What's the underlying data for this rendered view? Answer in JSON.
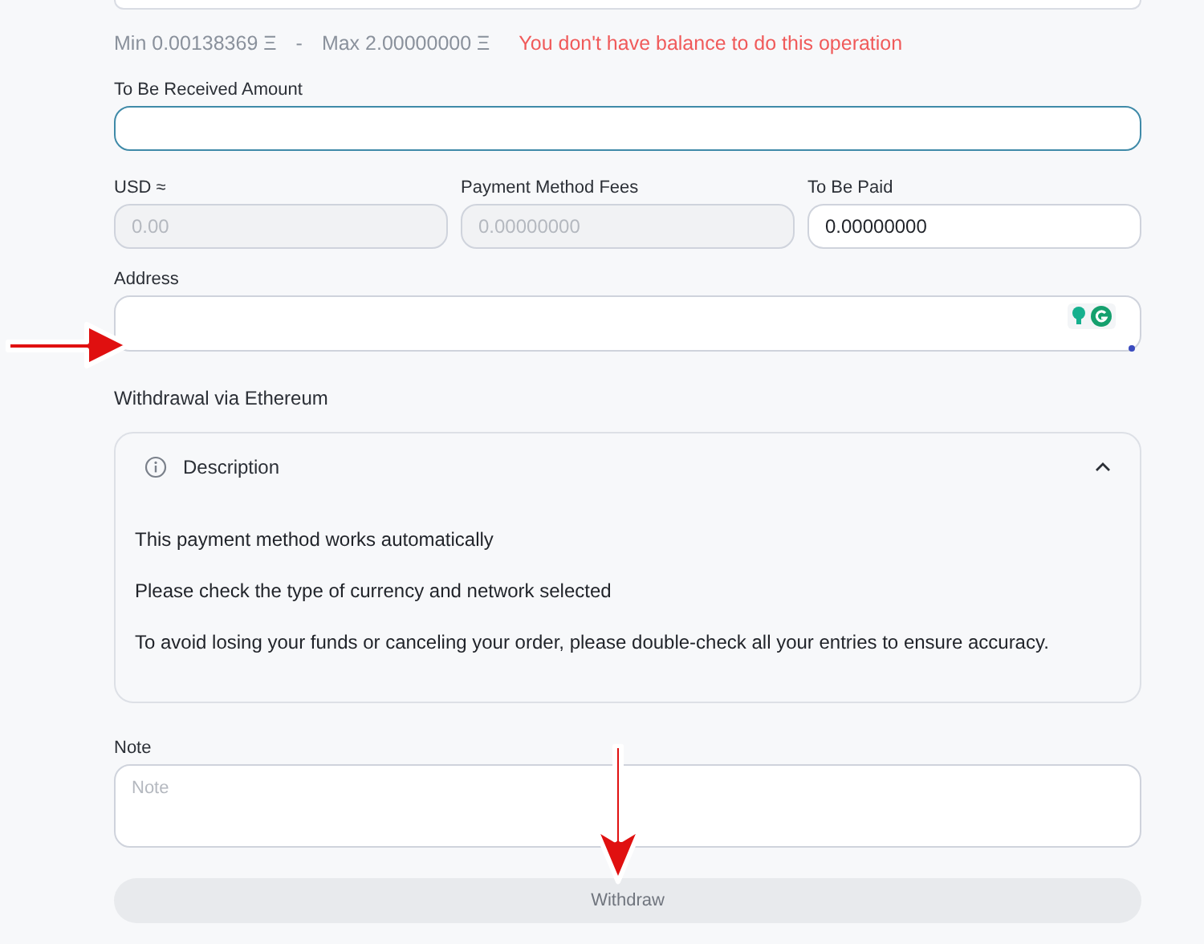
{
  "limits": {
    "min": "Min 0.00138369 Ξ",
    "separator": "-",
    "max": "Max 2.00000000 Ξ",
    "error": "You don't have balance to do this operation"
  },
  "received": {
    "label": "To Be Received Amount",
    "focused": true
  },
  "amounts": [
    {
      "label": "USD ≈",
      "value": "0.00",
      "disabled": true
    },
    {
      "label": "Payment Method Fees",
      "value": "0.00000000",
      "disabled": true
    },
    {
      "label": "To Be Paid",
      "value": "0.00000000",
      "disabled": false
    }
  ],
  "address": {
    "label": "Address"
  },
  "method_title": "Withdrawal via Ethereum",
  "description": {
    "title": "Description",
    "expanded": true,
    "lines": [
      "This payment method works automatically",
      "Please check the type of currency and network selected",
      "To avoid losing your funds or canceling your order, please double-check all your entries to ensure accuracy."
    ]
  },
  "note": {
    "label": "Note",
    "placeholder": "Note"
  },
  "withdraw": {
    "label": "Withdraw",
    "disabled": true
  }
}
